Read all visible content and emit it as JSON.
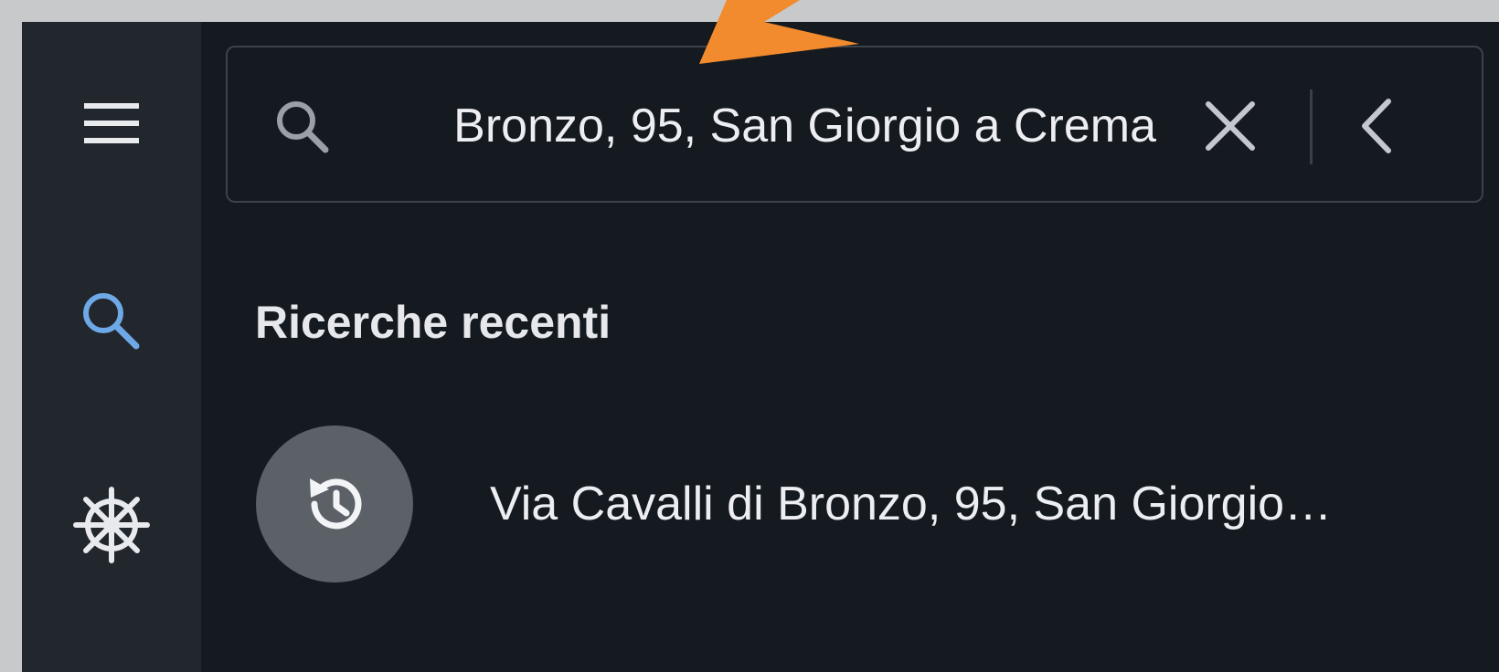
{
  "sidebar": {
    "items": [
      {
        "icon": "menu-icon"
      },
      {
        "icon": "search-icon",
        "active": true
      },
      {
        "icon": "ship-wheel-icon"
      }
    ]
  },
  "search": {
    "value": "Bronzo, 95, San Giorgio a Crema",
    "search_icon": "search-icon",
    "clear_icon": "close-icon",
    "back_icon": "chevron-left-icon"
  },
  "recent": {
    "title": "Ricerche recenti",
    "items": [
      {
        "icon": "history-icon",
        "label": "Via Cavalli di Bronzo, 95, San Giorgio…"
      }
    ]
  },
  "colors": {
    "app_background": "#151920",
    "sidebar_background": "#22262d",
    "accent": "#6ea8e6",
    "annotation_arrow": "#f28a2e",
    "history_avatar": "#5c6168"
  }
}
